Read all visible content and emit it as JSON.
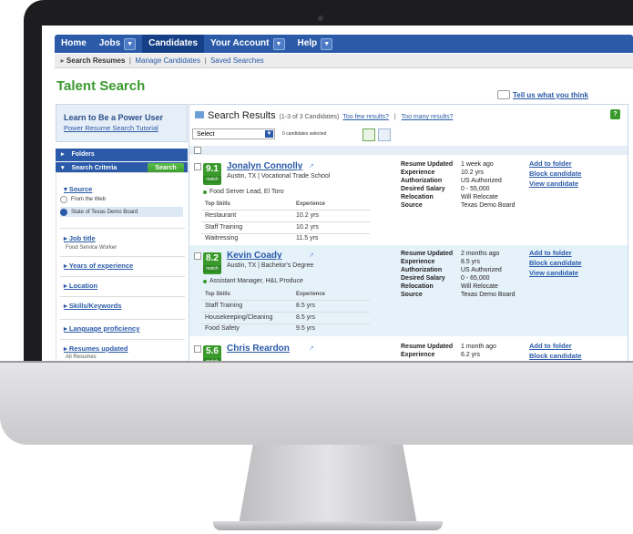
{
  "nav": {
    "items": [
      "Home",
      "Jobs",
      "Candidates",
      "Your Account",
      "Help"
    ],
    "active": "Candidates"
  },
  "subnav": {
    "items": [
      "Search Resumes",
      "Manage Candidates",
      "Saved Searches"
    ]
  },
  "page_title": "Talent Search",
  "feedback_link": "Tell us what you think",
  "sidebar": {
    "learn_title": "Learn to Be a Power User",
    "learn_link": "Power Resume Search Tutorial",
    "folders": "Folders",
    "search_criteria": "Search Criteria",
    "search_button": "Search",
    "source_label": "Source",
    "source_options": [
      "From the Web",
      "State of Texas Demo Board"
    ],
    "source_selected": "State of Texas Demo Board",
    "facets": [
      {
        "label": "Job title",
        "sub": "Food Service Worker"
      },
      {
        "label": "Years of experience",
        "sub": ""
      },
      {
        "label": "Location",
        "sub": ""
      },
      {
        "label": "Skills/Keywords",
        "sub": ""
      },
      {
        "label": "Language proficiency",
        "sub": ""
      },
      {
        "label": "Resumes updated",
        "sub": "All Resumes"
      }
    ]
  },
  "results": {
    "heading": "Search Results",
    "count": "(1-3 of 3 Candidates)",
    "too_few": "Too few results?",
    "too_many": "Too many results?",
    "select_value": "Select",
    "selected_count": "0 candidates selected",
    "skills_header": "Top Skills",
    "experience_header": "Experience",
    "match_label": "match",
    "meta_labels": [
      "Resume Updated",
      "Experience",
      "Authorization",
      "Desired Salary",
      "Relocation",
      "Source"
    ],
    "actions": [
      "Add to folder",
      "Block candidate",
      "View candidate"
    ]
  },
  "candidates": [
    {
      "score": "9.1",
      "name": "Jonalyn Connolly",
      "location": "Austin, TX | Vocational Trade School",
      "title": "Food Server Lead, El Toro",
      "skills": [
        {
          "skill": "Restaurant",
          "exp": "10.2 yrs"
        },
        {
          "skill": "Staff Training",
          "exp": "10.2 yrs"
        },
        {
          "skill": "Waitressing",
          "exp": "11.5 yrs"
        }
      ],
      "meta": [
        "1 week ago",
        "10.2 yrs",
        "US Authorized",
        "0 - 55,000",
        "Will Relocate",
        "Texas Demo Board"
      ]
    },
    {
      "score": "8.2",
      "name": "Kevin Coady",
      "location": "Austin, TX | Bachelor's Degree",
      "title": "Assistant Manager, H&L Produce",
      "skills": [
        {
          "skill": "Staff Training",
          "exp": "8.5 yrs"
        },
        {
          "skill": "Housekeeping/Cleaning",
          "exp": "8.5 yrs"
        },
        {
          "skill": "Food Safety",
          "exp": "9.5 yrs"
        }
      ],
      "meta": [
        "2 months ago",
        "8.5 yrs",
        "US Authorized",
        "0 - 65,000",
        "Will Relocate",
        "Texas Demo Board"
      ]
    },
    {
      "score": "5.6",
      "name": "Chris Reardon",
      "location": "",
      "title": "",
      "skills": [],
      "meta": [
        "1 month ago",
        "6.2 yrs",
        "",
        "",
        "",
        ""
      ]
    }
  ]
}
